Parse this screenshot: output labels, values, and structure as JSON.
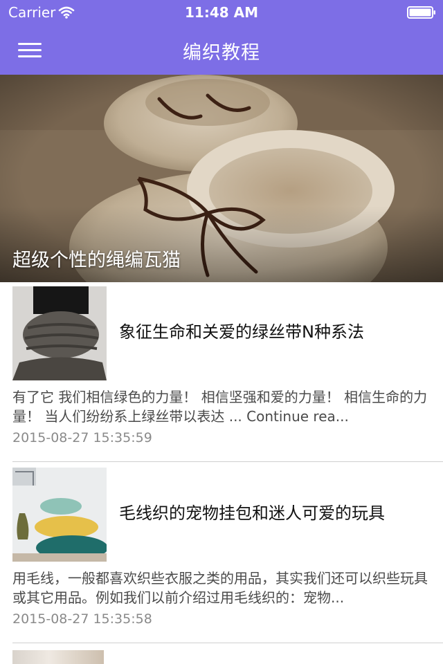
{
  "status_bar": {
    "carrier": "Carrier",
    "time": "11:48 AM"
  },
  "nav": {
    "title": "编织教程",
    "menu_icon": "hamburger-menu-icon"
  },
  "hero": {
    "title": "超级个性的绳编瓦猫"
  },
  "articles": [
    {
      "title": "象征生命和关爱的绿丝带N种系法",
      "summary": "有了它 我们相信绿色的力量！ 相信坚强和爱的力量！ 相信生命的力量！ 当人们纷纷系上绿丝带以表达 ... Continue rea...",
      "date": "2015-08-27 15:35:59"
    },
    {
      "title": "毛线织的宠物挂包和迷人可爱的玩具",
      "summary": "用毛线，一般都喜欢织些衣服之类的用品，其实我们还可以织些玩具或其它用品。例如我们以前介绍过用毛线织的：宠物...",
      "date": "2015-08-27 15:35:58"
    }
  ],
  "colors": {
    "header": "#7d6ee6",
    "title_text": "#111111",
    "summary_text": "#4a4a4a",
    "date_text": "#8a8a8a"
  }
}
